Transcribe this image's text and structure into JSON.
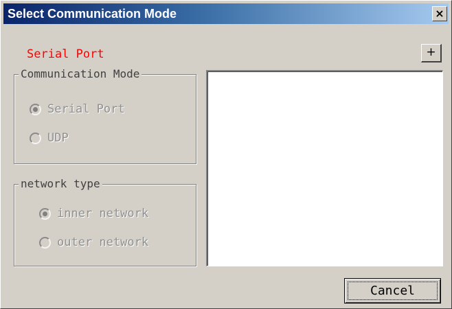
{
  "window": {
    "title": "Select Communication Mode",
    "close_label": "×"
  },
  "status_label": "Serial Port",
  "add_button_label": "+",
  "communication_mode": {
    "legend": "Communication Mode",
    "options": [
      {
        "label": "Serial Port",
        "selected": true
      },
      {
        "label": "UDP",
        "selected": false
      }
    ]
  },
  "network_type": {
    "legend": "network type",
    "options": [
      {
        "label": "inner network",
        "selected": true
      },
      {
        "label": "outer network",
        "selected": false
      }
    ]
  },
  "cancel_label": "Cancel",
  "colors": {
    "status_text": "#ff0000",
    "title_bar_start": "#0a246a",
    "title_bar_end": "#a6caf0",
    "dialog_background": "#d4d0c8"
  }
}
